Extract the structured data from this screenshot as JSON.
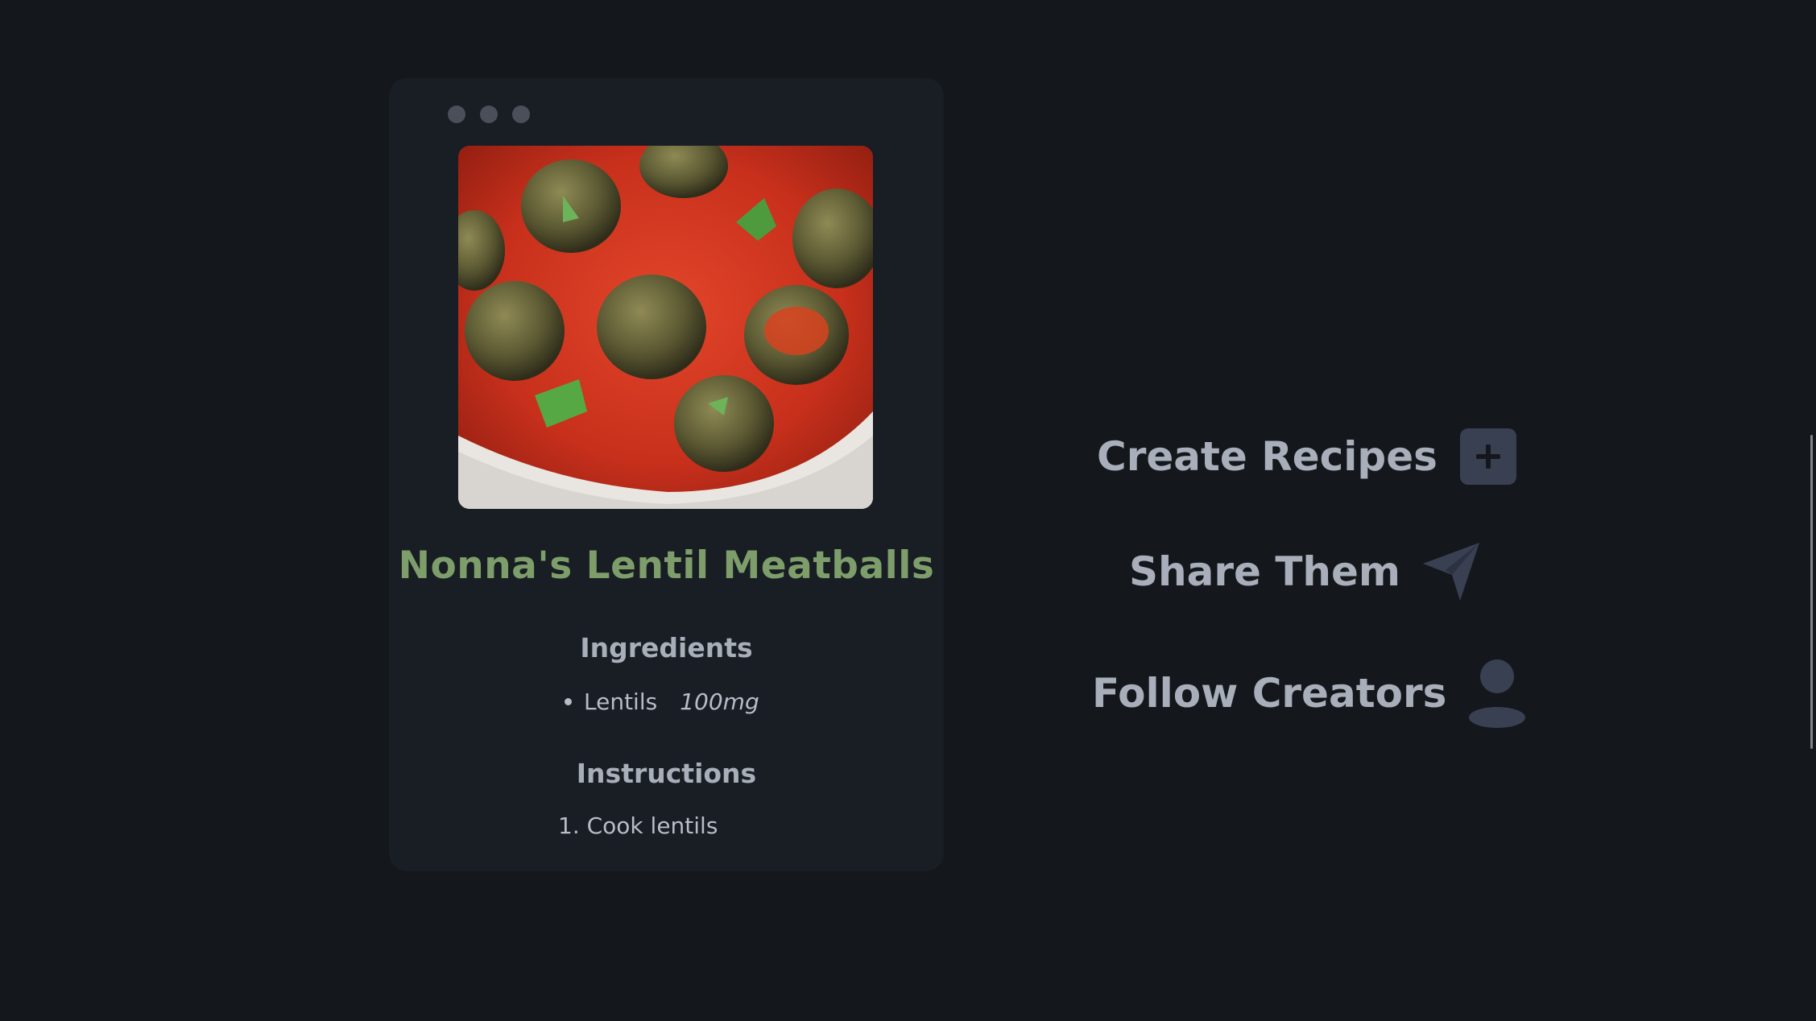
{
  "window": {
    "dots": [
      "window-dot-1",
      "window-dot-2",
      "window-dot-3"
    ]
  },
  "recipe": {
    "title": "Nonna's Lentil Meatballs",
    "ingredients_heading": "Ingredients",
    "ingredients": [
      {
        "name": "Lentils",
        "quantity": "100mg"
      }
    ],
    "instructions_heading": "Instructions",
    "instructions": [
      {
        "text": "1. Cook lentils"
      }
    ]
  },
  "features": [
    {
      "label": "Create Recipes",
      "icon": "plus-icon"
    },
    {
      "label": "Share Them",
      "icon": "paper-plane-icon"
    },
    {
      "label": "Follow Creators",
      "icon": "user-icon"
    }
  ],
  "colors": {
    "background": "#14171c",
    "card": "#191d24",
    "title_green": "#7d9e6a",
    "text": "#a9afba",
    "icon": "#394052"
  }
}
